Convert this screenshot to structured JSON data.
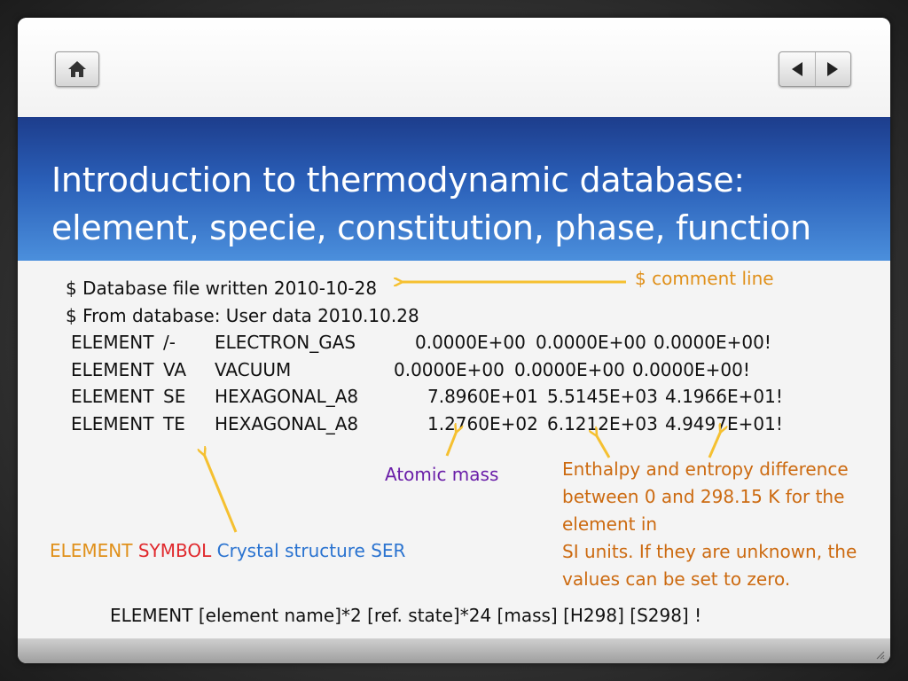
{
  "icons": {
    "home": "home-icon",
    "prev": "triangle-left-icon",
    "next": "triangle-right-icon"
  },
  "title": {
    "line1": "Introduction to thermodynamic database:",
    "line2": "element, specie, constitution, phase, function"
  },
  "code": {
    "comment1": "$ Database file written 2010-10-28",
    "comment2": "$ From database: User data 2010.10.28",
    "rows": [
      {
        "keyword": "ELEMENT",
        "symbol": "/-",
        "structure": "ELECTRON_GAS",
        "mass": "0.0000E+00",
        "h298": "0.0000E+00",
        "s298": "0.0000E+00!"
      },
      {
        "keyword": "ELEMENT",
        "symbol": "VA",
        "structure": "VACUUM",
        "mass": "0.0000E+00",
        "h298": "0.0000E+00",
        "s298": "0.0000E+00!"
      },
      {
        "keyword": "ELEMENT",
        "symbol": "SE",
        "structure": "HEXAGONAL_A8",
        "mass": "7.8960E+01",
        "h298": "5.5145E+03",
        "s298": "4.1966E+01!"
      },
      {
        "keyword": "ELEMENT",
        "symbol": "TE",
        "structure": "HEXAGONAL_A8",
        "mass": "1.2760E+02",
        "h298": "6.1212E+03",
        "s298": "4.9497E+01!"
      }
    ]
  },
  "annotations": {
    "comment_line": "$ comment line",
    "atomic_mass": "Atomic mass",
    "legend_element": "ELEMENT",
    "legend_symbol": "SYMBOL",
    "legend_structure": "Crystal structure SER",
    "enthalpy_line1": "Enthalpy and entropy difference",
    "enthalpy_line2": "between 0 and 298.15 K for the",
    "enthalpy_line3": "element in",
    "enthalpy_line4": "SI units. If they are unknown, the",
    "enthalpy_line5": "values can be set to zero."
  },
  "syntax": "ELEMENT [element name]*2 [ref. state]*24 [mass] [H298] [S298] !",
  "colors": {
    "banner_top": "#1d3d8c",
    "banner_bottom": "#4b8fdc",
    "arrow": "#f5c030",
    "orange": "#e0901a",
    "red": "#e0282c",
    "blue": "#2a73d0",
    "purple": "#6a1ea8",
    "brown": "#cc6a10"
  }
}
